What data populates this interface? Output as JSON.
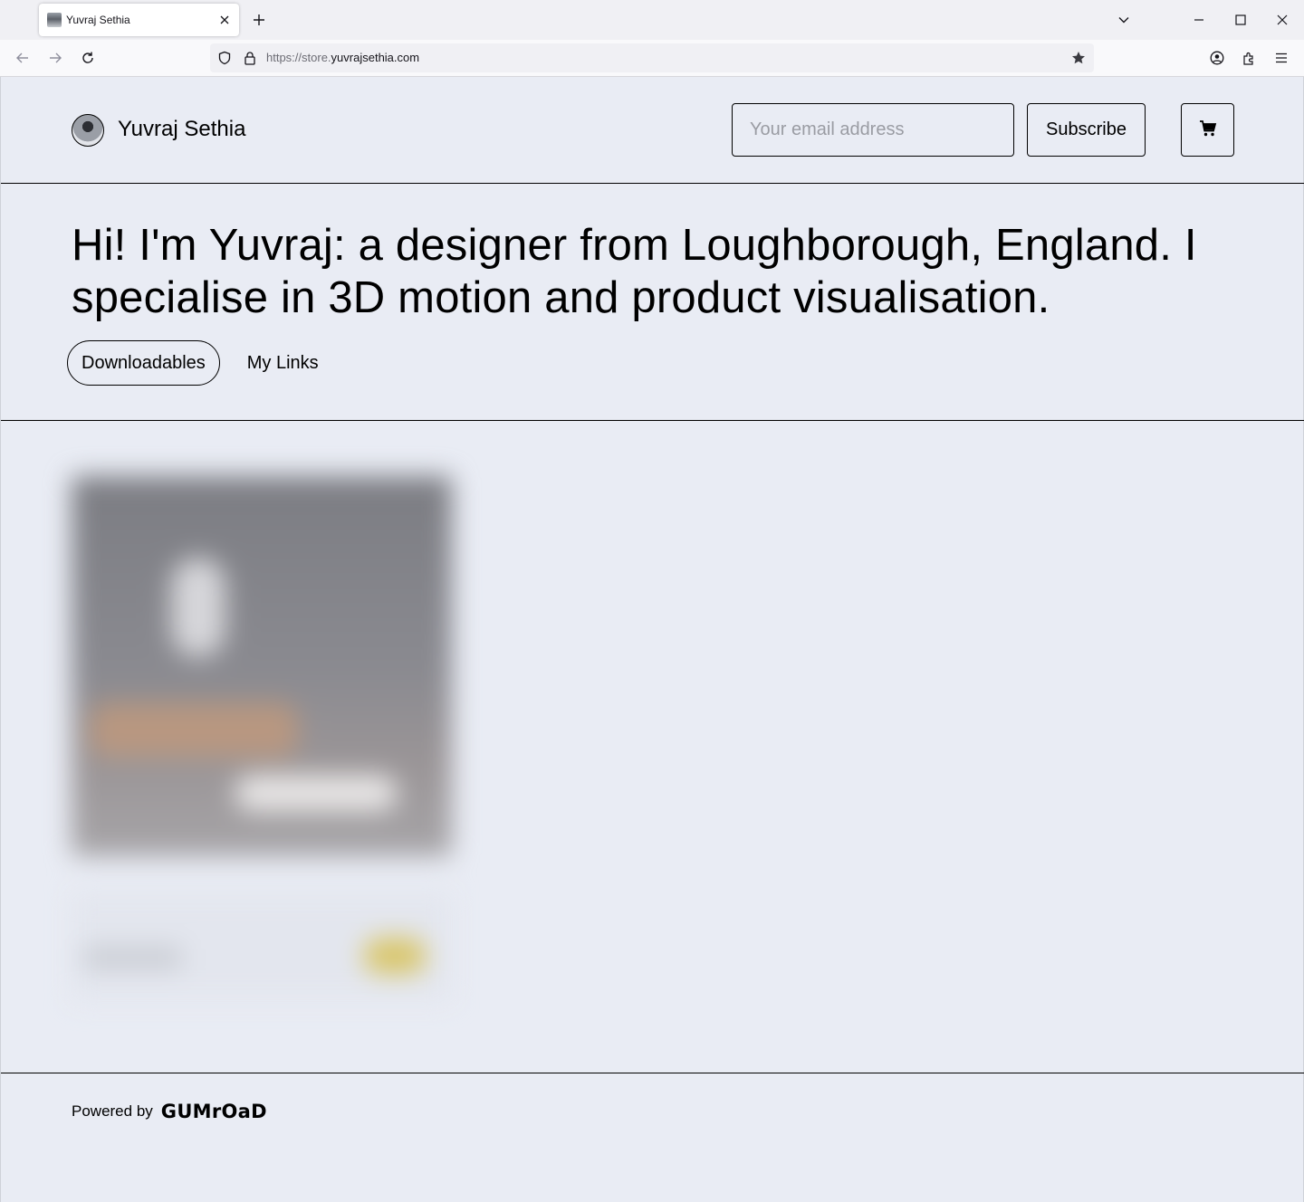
{
  "browser": {
    "tab_title": "Yuvraj Sethia",
    "url_dim": "https://store.",
    "url_main": "yuvrajsethia.com"
  },
  "header": {
    "site_name": "Yuvraj Sethia",
    "email_placeholder": "Your email address",
    "subscribe_label": "Subscribe"
  },
  "hero": {
    "bio": "Hi! I'm Yuvraj: a designer from Loughborough, England. I specialise in 3D motion and product visualisation.",
    "tabs": [
      {
        "label": "Downloadables",
        "active": true
      },
      {
        "label": "My Links",
        "active": false
      }
    ]
  },
  "footer": {
    "powered_by": "Powered by",
    "brand": "GUMrOaD"
  },
  "colors": {
    "page_bg": "#e9ecf4",
    "border": "#000000",
    "price_badge": "#d9c66a"
  },
  "icons": {
    "cart": "shopping-cart-icon",
    "lock": "lock-icon",
    "shield": "tracking-shield-icon",
    "star": "bookmark-star-icon"
  }
}
